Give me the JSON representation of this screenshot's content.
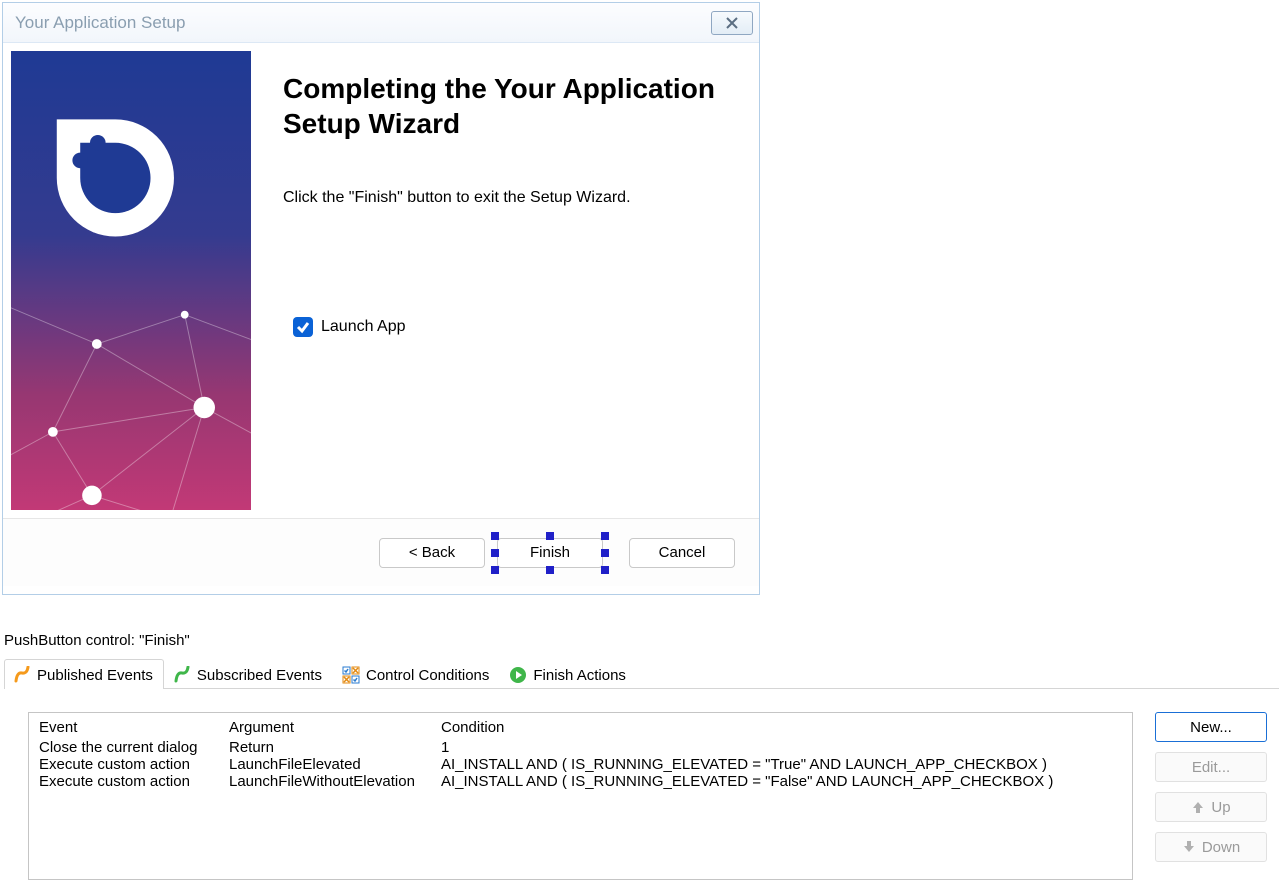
{
  "dialog": {
    "title": "Your Application Setup",
    "heading": "Completing the Your Application Setup Wizard",
    "instruction": "Click the \"Finish\" button to exit the Setup Wizard.",
    "checkbox_label": "Launch App",
    "back_label": "< Back",
    "finish_label": "Finish",
    "cancel_label": "Cancel"
  },
  "properties_title": "PushButton control: \"Finish\"",
  "tabs": {
    "published": "Published Events",
    "subscribed": "Subscribed Events",
    "control": "Control Conditions",
    "finish": "Finish Actions"
  },
  "events_headers": {
    "event": "Event",
    "argument": "Argument",
    "condition": "Condition"
  },
  "events": [
    {
      "event": "Close the current dialog",
      "argument": "Return",
      "condition": "1"
    },
    {
      "event": "Execute custom action",
      "argument": "LaunchFileElevated",
      "condition": "AI_INSTALL AND ( IS_RUNNING_ELEVATED = \"True\" AND LAUNCH_APP_CHECKBOX )"
    },
    {
      "event": "Execute custom action",
      "argument": "LaunchFileWithoutElevation",
      "condition": "AI_INSTALL AND ( IS_RUNNING_ELEVATED = \"False\" AND LAUNCH_APP_CHECKBOX )"
    }
  ],
  "side_buttons": {
    "new_": "New...",
    "edit": "Edit...",
    "up": "Up",
    "down": "Down"
  }
}
